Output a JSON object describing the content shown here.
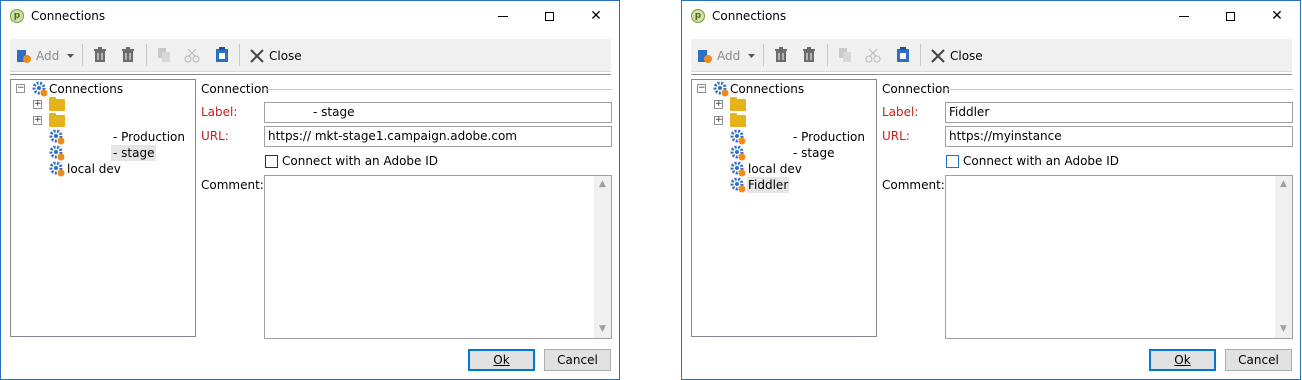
{
  "windows": [
    {
      "title": "Connections",
      "app_icon_letter": "p",
      "toolbar": {
        "add": "Add",
        "close": "Close"
      },
      "tree": {
        "root": "Connections",
        "items": [
          {
            "type": "folder",
            "label": ""
          },
          {
            "type": "folder",
            "label": ""
          },
          {
            "type": "connection",
            "label": "- Production",
            "selected": false
          },
          {
            "type": "connection",
            "label": "- stage",
            "selected": true
          },
          {
            "type": "connection",
            "label": "local dev",
            "selected": false
          }
        ]
      },
      "form": {
        "section_title": "Connection",
        "label_caption": "Label:",
        "label_value": "- stage",
        "url_caption": "URL:",
        "url_value": "https://              mkt-stage1.campaign.adobe.com",
        "adobe_id_label": "Connect with an Adobe ID",
        "adobe_id_checked": false,
        "comment_caption": "Comment:",
        "comment_value": ""
      },
      "buttons": {
        "ok": "Ok",
        "cancel": "Cancel"
      }
    },
    {
      "title": "Connections",
      "app_icon_letter": "p",
      "toolbar": {
        "add": "Add",
        "close": "Close"
      },
      "tree": {
        "root": "Connections",
        "items": [
          {
            "type": "folder",
            "label": ""
          },
          {
            "type": "folder",
            "label": ""
          },
          {
            "type": "connection",
            "label": "- Production",
            "selected": false
          },
          {
            "type": "connection",
            "label": "- stage",
            "selected": false
          },
          {
            "type": "connection",
            "label": "local dev",
            "selected": false
          },
          {
            "type": "connection",
            "label": "Fiddler",
            "selected": true
          }
        ]
      },
      "form": {
        "section_title": "Connection",
        "label_caption": "Label:",
        "label_value": "Fiddler",
        "url_caption": "URL:",
        "url_value": "https://myinstance",
        "adobe_id_label": "Connect with an Adobe ID",
        "adobe_id_checked": false,
        "comment_caption": "Comment:",
        "comment_value": ""
      },
      "buttons": {
        "ok": "Ok",
        "cancel": "Cancel"
      }
    }
  ],
  "colors": {
    "accent": "#0078d7",
    "required_label": "#c81e1e",
    "folder": "#e6b41a",
    "gear": "#2e6fc4",
    "gear_badge": "#f08a1c"
  },
  "icons": [
    "minimize-icon",
    "maximize-icon",
    "close-icon",
    "add-connection-icon",
    "dropdown-arrow-icon",
    "delete-icon",
    "delete-all-icon",
    "copy-icon",
    "cut-icon",
    "paste-icon",
    "close-x-icon",
    "folder-icon",
    "gear-connection-icon",
    "scroll-up-icon",
    "scroll-down-icon"
  ]
}
